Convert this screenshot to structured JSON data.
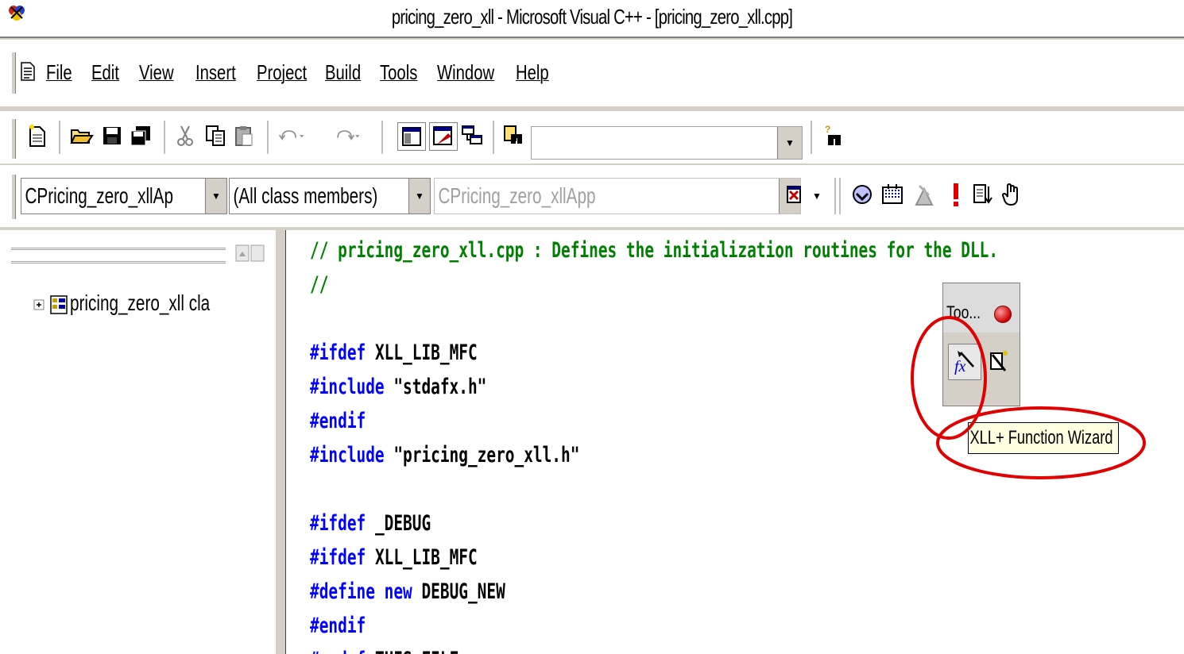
{
  "window": {
    "title": "pricing_zero_xll - Microsoft Visual C++ - [pricing_zero_xll.cpp]"
  },
  "menu": {
    "items": [
      {
        "label": "File"
      },
      {
        "label": "Edit"
      },
      {
        "label": "View"
      },
      {
        "label": "Insert"
      },
      {
        "label": "Project"
      },
      {
        "label": "Build"
      },
      {
        "label": "Tools"
      },
      {
        "label": "Window"
      },
      {
        "label": "Help"
      }
    ]
  },
  "toolbar": {
    "find_combo_value": "",
    "class_combo_value": "CPricing_zero_xllAp",
    "filter_combo_value": "(All class members)",
    "member_combo_value": "CPricing_zero_xllApp"
  },
  "class_view": {
    "tree_root_label": "pricing_zero_xll cla"
  },
  "editor": {
    "lines": [
      {
        "kind": "comment",
        "text": "// pricing_zero_xll.cpp : Defines the initialization routines for the DLL."
      },
      {
        "kind": "comment",
        "text": "//"
      },
      {
        "kind": "blank",
        "text": ""
      },
      {
        "kind": "directive",
        "kw": "#ifdef",
        "rest": " XLL_LIB_MFC"
      },
      {
        "kind": "directive",
        "kw": "#include",
        "rest": " \"stdafx.h\""
      },
      {
        "kind": "directive",
        "kw": "#endif",
        "rest": ""
      },
      {
        "kind": "directive",
        "kw": "#include",
        "rest": " \"pricing_zero_xll.h\""
      },
      {
        "kind": "blank",
        "text": ""
      },
      {
        "kind": "directive",
        "kw": "#ifdef",
        "rest": " _DEBUG"
      },
      {
        "kind": "directive",
        "kw": "#ifdef",
        "rest": " XLL_LIB_MFC"
      },
      {
        "kind": "define",
        "kw": "#define",
        "kw2": " new",
        "rest": " DEBUG_NEW"
      },
      {
        "kind": "directive",
        "kw": "#endif",
        "rest": ""
      },
      {
        "kind": "directive",
        "kw": "#undef",
        "rest": " THIS_FILE"
      }
    ]
  },
  "floating_toolbar": {
    "title": "Too..."
  },
  "tooltip": {
    "text": "XLL+ Function Wizard"
  },
  "colors": {
    "comment": "#008000",
    "keyword": "#0000ff",
    "annotation": "#e00000",
    "tooltip_bg": "#ffffe1"
  }
}
